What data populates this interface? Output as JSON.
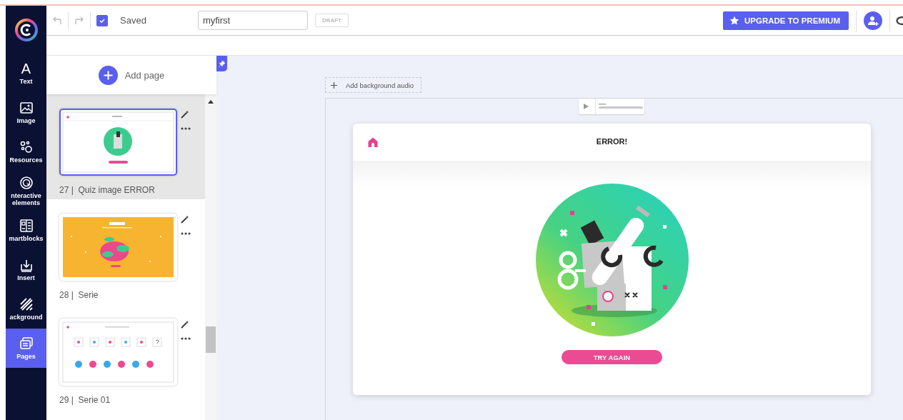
{
  "toolbar": {
    "undo": {
      "disabled": true
    },
    "redo": {
      "disabled": true
    },
    "saved": {
      "checked": true,
      "label": "Saved"
    },
    "title_field": {
      "value": "myfirst"
    },
    "status": "DRAFT",
    "upgrade_button": "UPGRADE TO PREMIUM"
  },
  "nav": [
    {
      "kind": "text",
      "glyph": "A",
      "label": "Text",
      "selected": false
    },
    {
      "kind": "image",
      "label": "Image",
      "selected": false
    },
    {
      "kind": "resources",
      "label": "Resources",
      "selected": false
    },
    {
      "kind": "interactive",
      "label": "nteractive elements",
      "selected": false
    },
    {
      "kind": "smartblocks",
      "label": "martblocks",
      "selected": false
    },
    {
      "kind": "insert",
      "label": "Insert",
      "selected": false
    },
    {
      "kind": "background",
      "label": "ackground",
      "selected": false
    },
    {
      "kind": "pages",
      "label": "Pages",
      "selected": true
    }
  ],
  "pages_panel": {
    "add_page": "Add page",
    "pages": [
      {
        "label": "27 |  Quiz image ERROR",
        "kind": "error",
        "selected": true
      },
      {
        "label": "28 |  Serie",
        "kind": "orange",
        "selected": false
      },
      {
        "label": "29 |  Serie 01",
        "kind": "sequence",
        "selected": false
      }
    ]
  },
  "canvas": {
    "add_audio": "Add background audio",
    "card": {
      "title": "ERROR!",
      "button": "TRY AGAIN"
    }
  }
}
